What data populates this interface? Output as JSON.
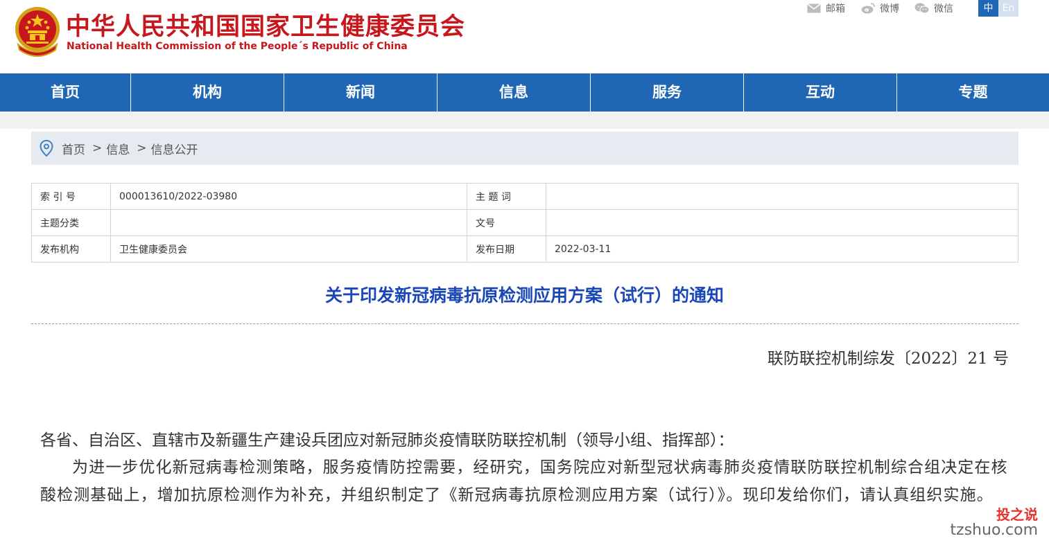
{
  "header": {
    "title_cn": "中华人民共和国国家卫生健康委员会",
    "title_en": "National Health Commission of the People´s Republic of China",
    "links": [
      {
        "label": "邮箱",
        "icon": "mail-icon"
      },
      {
        "label": "微博",
        "icon": "weibo-icon"
      },
      {
        "label": "微信",
        "icon": "wechat-icon"
      }
    ],
    "lang_cn": "中",
    "lang_en": "En"
  },
  "nav": {
    "items": [
      "首页",
      "机构",
      "新闻",
      "信息",
      "服务",
      "互动",
      "专题"
    ]
  },
  "breadcrumb": {
    "items": [
      "首页",
      "信息",
      "信息公开"
    ],
    "separator": ">"
  },
  "meta": {
    "rows": [
      {
        "label1": "索 引 号",
        "value1": "000013610/2022-03980",
        "label2": "主 题 词",
        "value2": ""
      },
      {
        "label1": "主题分类",
        "value1": "",
        "label2": "文号",
        "value2": ""
      },
      {
        "label1": "发布机构",
        "value1": "卫生健康委员会",
        "label2": "发布日期",
        "value2": "2022-03-11"
      }
    ]
  },
  "article": {
    "title": "关于印发新冠病毒抗原检测应用方案（试行）的通知",
    "doc_number": "联防联控机制综发〔2022〕21 号",
    "salutation": "各省、自治区、直辖市及新疆生产建设兵团应对新冠肺炎疫情联防联控机制（领导小组、指挥部）：",
    "body": "为进一步优化新冠病毒检测策略，服务疫情防控需要，经研究，国务院应对新型冠状病毒肺炎疫情联防联控机制综合组决定在核酸检测基础上，增加抗原检测作为补充，并组织制定了《新冠病毒抗原检测应用方案（试行）》。现印发给你们，请认真组织实施。"
  },
  "watermark": {
    "cn": "投之说",
    "en": "tzshuo.com"
  },
  "colors": {
    "brand_red": "#c8161d",
    "nav_blue": "#1f66b4",
    "title_blue": "#1a47b8",
    "breadcrumb_bg": "#e6ebf2"
  }
}
